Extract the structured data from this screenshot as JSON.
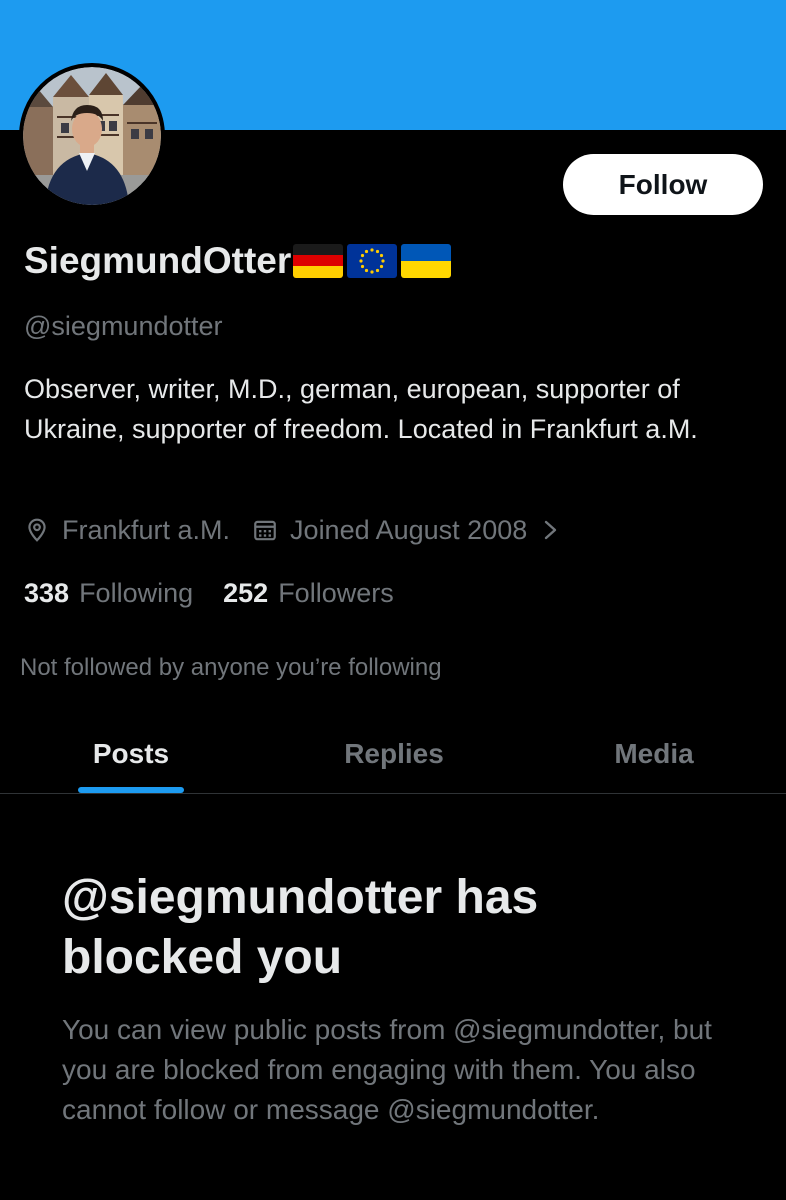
{
  "profile": {
    "display_name": "SiegmundOtter",
    "flags": [
      "germany-flag",
      "eu-flag",
      "ukraine-flag"
    ],
    "handle": "@siegmundotter",
    "bio": "Observer, writer, M.D., german, european, supporter of Ukraine, supporter of freedom.  Located in Frankfurt a.M.",
    "location": "Frankfurt a.M.",
    "joined": "Joined August 2008",
    "following_count": "338",
    "following_label": "Following",
    "followers_count": "252",
    "followers_label": "Followers",
    "not_followed_text": "Not followed by anyone you’re following"
  },
  "actions": {
    "follow_label": "Follow"
  },
  "tabs": [
    {
      "label": "Posts",
      "active": true
    },
    {
      "label": "Replies",
      "active": false
    },
    {
      "label": "Media",
      "active": false
    }
  ],
  "blocked": {
    "title": "@siegmundotter has blocked you",
    "description": "You can view public posts from @siegmundotter, but you are blocked from engaging with them. You also cannot follow or message @siegmundotter."
  },
  "colors": {
    "banner": "#1d9bf0",
    "accent": "#1d9bf0",
    "background": "#000000",
    "primary_text": "#e7e9ea",
    "secondary_text": "#71767b"
  },
  "icons": {
    "location": "location-pin-icon",
    "calendar": "calendar-icon",
    "chevron": "chevron-right-icon"
  }
}
